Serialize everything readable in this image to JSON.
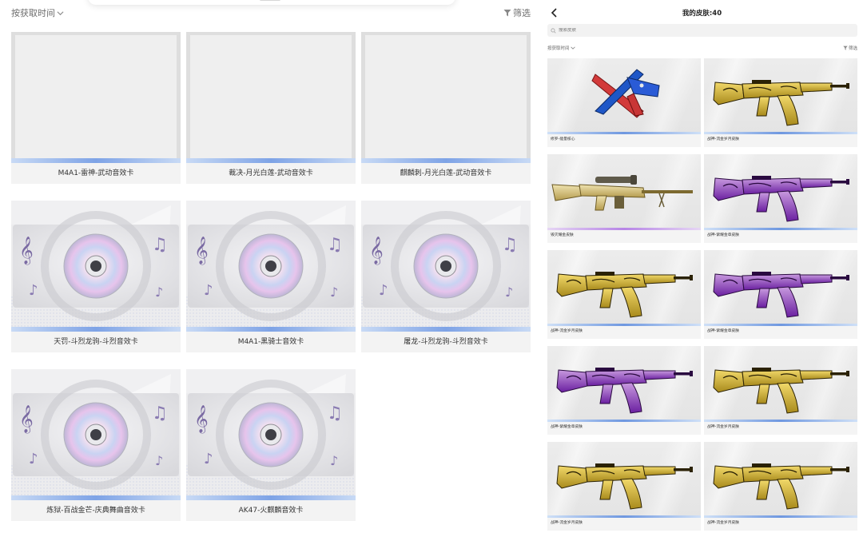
{
  "left_panel": {
    "sort_label": "按获取时间",
    "filter_label": "筛选",
    "cards": [
      {
        "name": "M4A1-雷神-武动音效卡",
        "art": "blank"
      },
      {
        "name": "裁决-月光白莲-武动音效卡",
        "art": "blank"
      },
      {
        "name": "麒麟刺-月光白莲-武动音效卡",
        "art": "blank"
      },
      {
        "name": "天罚-斗烈龙驹-斗烈音效卡",
        "art": "disc"
      },
      {
        "name": "M4A1-黑骑士音效卡",
        "art": "disc"
      },
      {
        "name": "屠龙-斗烈龙驹-斗烈音效卡",
        "art": "disc"
      },
      {
        "name": "炼狱-百战金芒-庆典舞曲音效卡",
        "art": "disc"
      },
      {
        "name": "AK47-火麒麟音效卡",
        "art": "disc"
      }
    ]
  },
  "right_panel": {
    "title": "我的皮肤:40",
    "search_placeholder": "搜索皮肤",
    "sort_label": "按获取时间",
    "filter_label": "筛选",
    "skins": [
      {
        "name": "修罗-能量核心",
        "kind": "knife"
      },
      {
        "name": "战神-流金岁月皮肤",
        "kind": "gold"
      },
      {
        "name": "毁灭耀金皮肤",
        "kind": "sniper"
      },
      {
        "name": "战神-紫耀金章皮肤",
        "kind": "purple"
      },
      {
        "name": "战神-流金岁月皮肤",
        "kind": "gold"
      },
      {
        "name": "战神-紫耀金章皮肤",
        "kind": "purple"
      },
      {
        "name": "战神-紫耀金章皮肤",
        "kind": "purple"
      },
      {
        "name": "战神-流金岁月皮肤",
        "kind": "gold"
      },
      {
        "name": "战神-流金岁月皮肤",
        "kind": "gold"
      },
      {
        "name": "战神-流金岁月皮肤",
        "kind": "gold"
      }
    ]
  },
  "icons": {
    "sort_chevron": "chevron-down-icon",
    "filter": "filter-icon",
    "back": "back-arrow-icon",
    "search": "search-icon",
    "disc": "cd-disc-icon",
    "music_note": "music-note-icon"
  },
  "colors": {
    "card_accent_blue": "#7ea3e6",
    "card_accent_purple": "#b785e6",
    "gold": "#c9a227",
    "purple_skin": "#7b2fb0"
  }
}
